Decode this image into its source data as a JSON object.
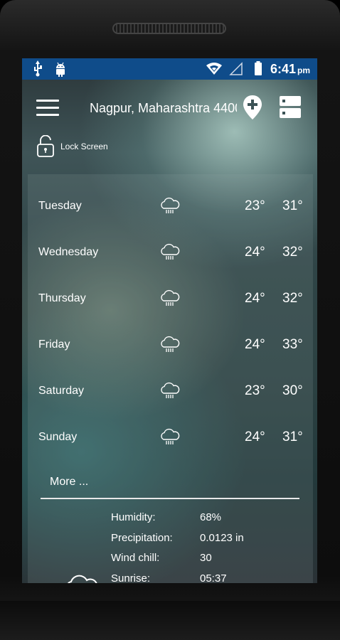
{
  "status_bar": {
    "time": "6:41",
    "ampm": "pm",
    "icons": [
      "usb-icon",
      "android-icon",
      "wifi-icon",
      "signal-icon",
      "battery-icon"
    ]
  },
  "header": {
    "location": "Nagpur, Maharashtra 4400",
    "lock_label": "Lock Screen"
  },
  "forecast": [
    {
      "day": "Tuesday",
      "icon": "rain-cloud-icon",
      "low": "23°",
      "high": "31°"
    },
    {
      "day": "Wednesday",
      "icon": "rain-cloud-icon",
      "low": "24°",
      "high": "32°"
    },
    {
      "day": "Thursday",
      "icon": "rain-cloud-icon",
      "low": "24°",
      "high": "32°"
    },
    {
      "day": "Friday",
      "icon": "rain-cloud-icon",
      "low": "24°",
      "high": "33°"
    },
    {
      "day": "Saturday",
      "icon": "rain-cloud-icon",
      "low": "23°",
      "high": "30°"
    },
    {
      "day": "Sunday",
      "icon": "rain-cloud-icon",
      "low": "24°",
      "high": "31°"
    }
  ],
  "more_label": "More ...",
  "details": [
    {
      "label": "Humidity:",
      "value": "68%"
    },
    {
      "label": "Precipitation:",
      "value": "0.0123 in"
    },
    {
      "label": "Wind chill:",
      "value": "30"
    },
    {
      "label": "Sunrise:",
      "value": "05:37"
    }
  ],
  "colors": {
    "status_bar": "#0f4c8a",
    "text": "#ffffff"
  }
}
